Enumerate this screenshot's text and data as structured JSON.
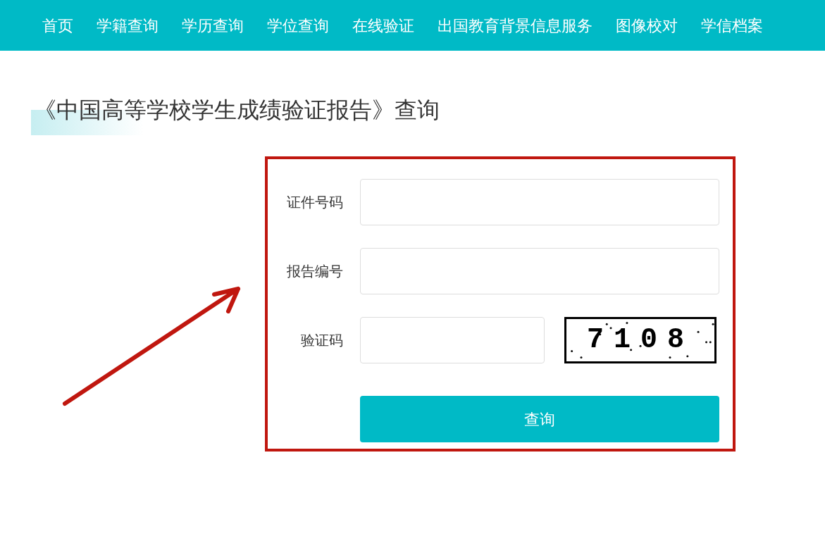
{
  "nav": {
    "items": [
      "首页",
      "学籍查询",
      "学历查询",
      "学位查询",
      "在线验证",
      "出国教育背景信息服务",
      "图像校对",
      "学信档案"
    ]
  },
  "title": "《中国高等学校学生成绩验证报告》查询",
  "form": {
    "fields": [
      {
        "kind": "text",
        "label": "证件号码"
      },
      {
        "kind": "text",
        "label": "报告编号"
      },
      {
        "kind": "captcha",
        "label": "验证码",
        "captcha": "7108"
      }
    ],
    "submit": "查询"
  }
}
